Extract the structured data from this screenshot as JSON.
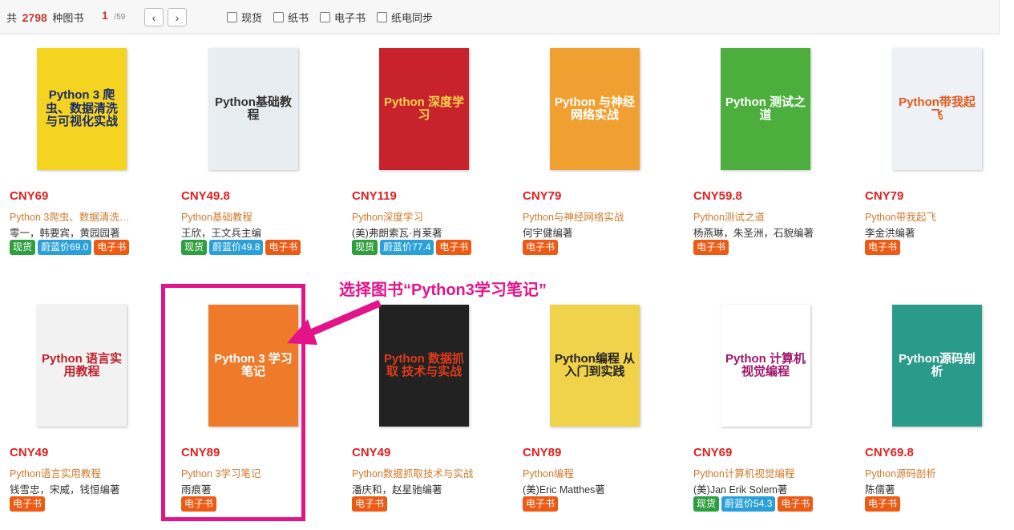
{
  "toolbar": {
    "total_prefix": "共",
    "total_count": "2798",
    "total_suffix": "种图书",
    "current_page": "1",
    "total_pages": "/59",
    "prev_icon": "‹",
    "next_icon": "›",
    "filters": [
      "现货",
      "纸书",
      "电子书",
      "纸电同步"
    ]
  },
  "books": [
    {
      "price": "CNY69",
      "title": "Python 3爬虫、数据清洗与可视化实战",
      "author": "零一，韩要宾，黄园园著",
      "badges": [
        "现货",
        "蔚蓝价69.0",
        "电子书"
      ],
      "cover": {
        "bg": "#f4d420",
        "fg": "#1a2a6a",
        "text": "Python 3 爬虫、数据清洗与可视化实战"
      }
    },
    {
      "price": "CNY49.8",
      "title": "Python基础教程",
      "author": "王欣，王文兵主编",
      "badges": [
        "现货",
        "蔚蓝价49.8",
        "电子书"
      ],
      "cover": {
        "bg": "#e8edf2",
        "fg": "#333",
        "text": "Python基础教程"
      }
    },
    {
      "price": "CNY119",
      "title": "Python深度学习",
      "author": "(美)弗朗索瓦·肖莱著",
      "badges": [
        "现货",
        "蔚蓝价77.4",
        "电子书"
      ],
      "cover": {
        "bg": "#c8232c",
        "fg": "#f7d64a",
        "text": "Python 深度学习"
      }
    },
    {
      "price": "CNY79",
      "title": "Python与神经网络实战",
      "author": "何宇健编著",
      "badges": [
        "电子书"
      ],
      "cover": {
        "bg": "#f0a030",
        "fg": "#ffffff",
        "text": "Python 与神经网络实战"
      }
    },
    {
      "price": "CNY59.8",
      "title": "Python测试之道",
      "author": "杨燕琳，朱圣洲，石貌编著",
      "badges": [
        "电子书"
      ],
      "cover": {
        "bg": "#4cae3c",
        "fg": "#ffffff",
        "text": "Python 测试之道"
      }
    },
    {
      "price": "CNY79",
      "title": "Python带我起飞",
      "author": "李金洪编著",
      "badges": [
        "电子书"
      ],
      "cover": {
        "bg": "#eef2f6",
        "fg": "#e05a1e",
        "text": "Python带我起飞"
      }
    },
    {
      "price": "CNY49",
      "title": "Python语言实用教程",
      "author": "钱雪忠，宋威，钱恒编著",
      "badges": [
        "电子书"
      ],
      "cover": {
        "bg": "#f2f2f2",
        "fg": "#c0202a",
        "text": "Python 语言实用教程"
      }
    },
    {
      "price": "CNY89",
      "title": "Python 3学习笔记",
      "author": "雨痕著",
      "badges": [
        "电子书"
      ],
      "cover": {
        "bg": "#ee7a2a",
        "fg": "#ffffff",
        "text": "Python 3 学习笔记"
      }
    },
    {
      "price": "CNY49",
      "title": "Python数据抓取技术与实战",
      "author": "潘庆和，赵星驰编著",
      "badges": [
        "电子书"
      ],
      "cover": {
        "bg": "#222222",
        "fg": "#e03a1a",
        "text": "Python 数据抓取 技术与实战"
      }
    },
    {
      "price": "CNY89",
      "title": "Python编程",
      "author": "(美)Eric Matthes著",
      "badges": [
        "电子书"
      ],
      "cover": {
        "bg": "#f0d34a",
        "fg": "#222",
        "text": "Python编程 从入门到实践"
      }
    },
    {
      "price": "CNY69",
      "title": "Python计算机视觉编程",
      "author": "(美)Jan Erik Solem著",
      "badges": [
        "现货",
        "蔚蓝价54.3",
        "电子书"
      ],
      "cover": {
        "bg": "#ffffff",
        "fg": "#a0156a",
        "text": "Python 计算机视觉编程"
      }
    },
    {
      "price": "CNY69.8",
      "title": "Python源码剖析",
      "author": "陈儒著",
      "badges": [
        "电子书"
      ],
      "cover": {
        "bg": "#2a9a8a",
        "fg": "#ffffff",
        "text": "Python源码剖析"
      }
    }
  ],
  "annotation": {
    "text": "选择图书“Python3学习笔记”",
    "color": "#e3138a"
  }
}
